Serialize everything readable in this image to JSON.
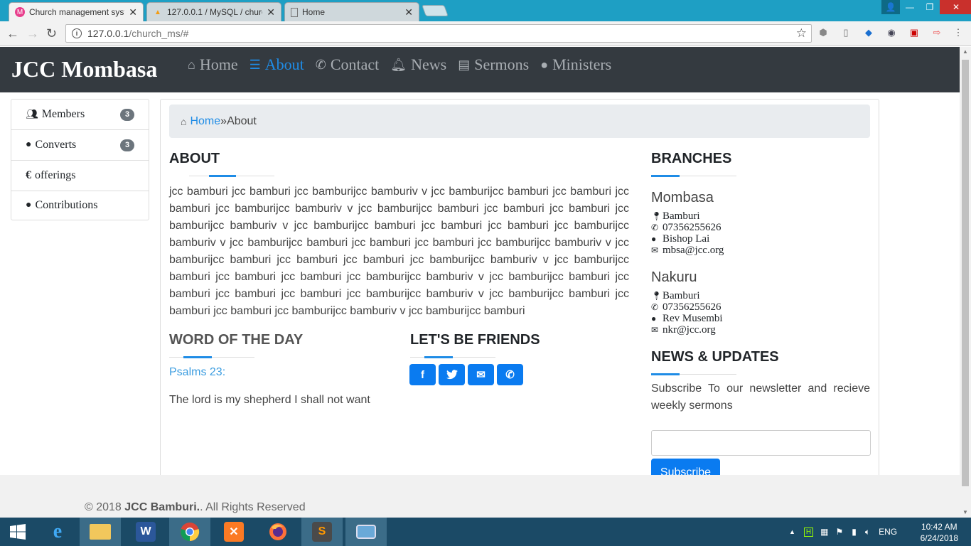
{
  "browser": {
    "tabs": [
      {
        "title": "Church management syst",
        "icon": "church-favicon",
        "active": true
      },
      {
        "title": "127.0.0.1 / MySQL / churc",
        "icon": "phpmyadmin-favicon",
        "active": false
      },
      {
        "title": "Home",
        "icon": "page-icon",
        "active": false
      }
    ],
    "url_host": "127.0.0.1",
    "url_path": "/church_ms/#"
  },
  "site": {
    "brand": "JCC Mombasa",
    "nav": [
      {
        "label": "Home",
        "icon": "home-icon"
      },
      {
        "label": "About",
        "icon": "list-icon",
        "active": true
      },
      {
        "label": "Contact",
        "icon": "phone-icon"
      },
      {
        "label": "News",
        "icon": "bell-icon"
      },
      {
        "label": "Sermons",
        "icon": "book-icon"
      },
      {
        "label": "Ministers",
        "icon": "user-icon"
      }
    ]
  },
  "sidebar": {
    "items": [
      {
        "label": "Members",
        "icon": "users-icon",
        "badge": "3"
      },
      {
        "label": "Converts",
        "icon": "user-icon",
        "badge": "3"
      },
      {
        "label": "offerings",
        "icon": "euro-icon",
        "symbol": "€"
      },
      {
        "label": "Contributions",
        "icon": "user-icon"
      }
    ]
  },
  "breadcrumb": {
    "home": "Home",
    "separator": " »",
    "current": "About"
  },
  "about": {
    "heading": "ABOUT",
    "text": "jcc bamburi jcc bamburi jcc bamburijcc bamburiv v jcc bamburijcc bamburi jcc bamburi jcc bamburi jcc bamburijcc bamburiv v jcc bamburijcc bamburi jcc bamburi jcc bamburi jcc bamburijcc bamburiv v jcc bamburijcc bamburi jcc bamburi jcc bamburi jcc bamburijcc bamburiv v jcc bamburijcc bamburi jcc bamburi jcc bamburi jcc bamburijcc bamburiv v jcc bamburijcc bamburi jcc bamburi jcc bamburi jcc bamburijcc bamburiv v jcc bamburijcc bamburi jcc bamburi jcc bamburi jcc bamburijcc bamburiv v jcc bamburijcc bamburi jcc bamburi jcc bamburi jcc bamburi jcc bamburijcc bamburiv v jcc bamburijcc bamburi jcc bamburi jcc bamburi jcc bamburijcc bamburiv v jcc bamburijcc bamburi"
  },
  "word_of_day": {
    "heading": "WORD OF THE DAY",
    "reference": "Psalms 23:",
    "verse": "The lord is my shepherd I shall not want"
  },
  "friends": {
    "heading": "LET'S BE FRIENDS",
    "buttons": [
      {
        "icon": "facebook-icon",
        "glyph": "f"
      },
      {
        "icon": "twitter-icon",
        "glyph": "🐦"
      },
      {
        "icon": "envelope-icon",
        "glyph": "✉"
      },
      {
        "icon": "phone-icon",
        "glyph": "✆"
      }
    ]
  },
  "branches": {
    "heading": "BRANCHES",
    "list": [
      {
        "name": "Mombasa",
        "location": "Bamburi",
        "phone": "07356255626",
        "minister": "Bishop Lai",
        "email": "mbsa@jcc.org"
      },
      {
        "name": "Nakuru",
        "location": "Bamburi",
        "phone": "07356255626",
        "minister": "Rev Musembi",
        "email": "nkr@jcc.org"
      }
    ]
  },
  "news": {
    "heading": "NEWS & UPDATES",
    "text": "Subscribe To our newsletter and recieve weekly sermons",
    "input_value": "",
    "button": "Subscribe"
  },
  "footer": {
    "prefix": "© 2018 ",
    "org": "JCC Bamburi.",
    "suffix": ". All Rights Reserved"
  },
  "taskbar": {
    "apps": [
      "start",
      "internet-explorer",
      "file-explorer",
      "word",
      "chrome",
      "xampp",
      "firefox",
      "sublime-text",
      "photos"
    ],
    "language": "ENG",
    "time": "10:42 AM",
    "date": "6/24/2018"
  },
  "colors": {
    "navbar": "#343a40",
    "accent": "#1f8ce6",
    "button": "#0a7bf0",
    "taskbar": "#1b4a66",
    "tabstrip": "#1e9fc4"
  }
}
